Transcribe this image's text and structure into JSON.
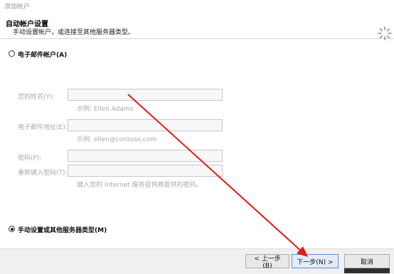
{
  "window": {
    "title": "添加帐户"
  },
  "header": {
    "title": "自动帐户设置",
    "subtitle": "手动设置帐户，或连接至其他服务器类型。"
  },
  "options": {
    "email_account": {
      "label": "电子邮件帐户(A)",
      "checked": false
    },
    "manual_setup": {
      "label": "手动设置或其他服务器类型(M)",
      "checked": true
    }
  },
  "form": {
    "name": {
      "label": "您的姓名(Y):",
      "value": "",
      "hint": "示例: Ellen Adams"
    },
    "email": {
      "label": "电子邮件地址(E):",
      "value": "",
      "hint": "示例: ellen@contoso.com"
    },
    "password": {
      "label": "密码(P):",
      "value": ""
    },
    "password_confirm": {
      "label": "重新键入密码(T):",
      "value": "",
      "hint": "键入您的 Internet 服务提供商提供的密码。"
    }
  },
  "buttons": {
    "back": "< 上一步(B)",
    "next": "下一步(N) >",
    "cancel": "取消"
  },
  "colors": {
    "annotation_arrow": "#e21a1a",
    "primary_button_border": "#5e8ed6"
  },
  "icons": {
    "header": "spinner-icon"
  }
}
